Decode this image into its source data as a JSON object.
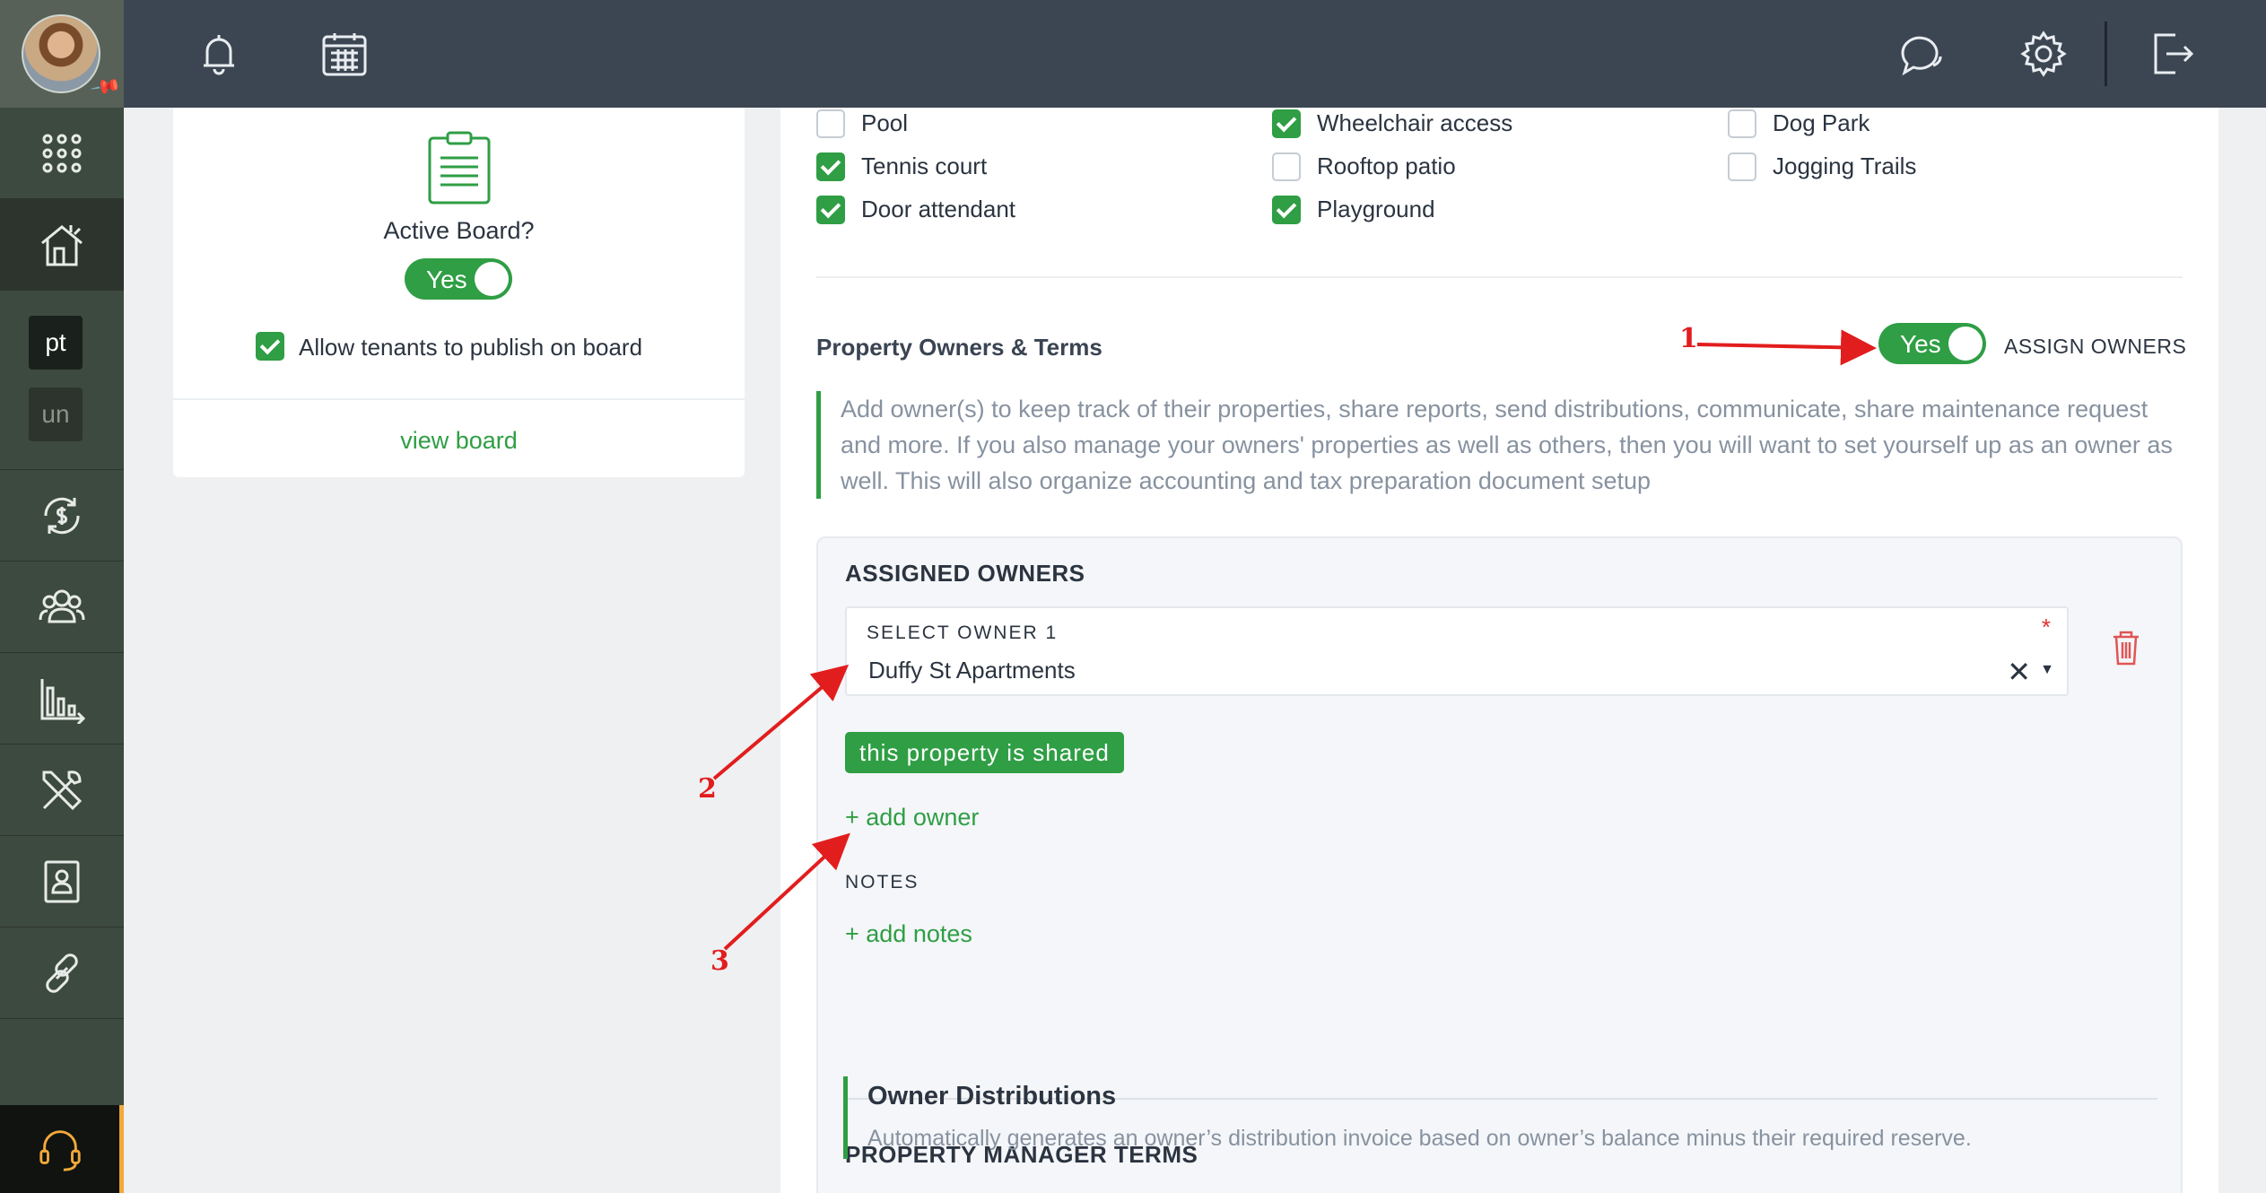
{
  "sidebar": {
    "workspaces": [
      "pt",
      "un"
    ]
  },
  "board": {
    "active_label": "Active Board?",
    "toggle_label": "Yes",
    "allow_label": "Allow tenants to publish on board",
    "view_link": "view board"
  },
  "amenities": [
    {
      "label": "Pool",
      "checked": false
    },
    {
      "label": "Wheelchair access",
      "checked": true
    },
    {
      "label": "Dog Park",
      "checked": false
    },
    {
      "label": "Tennis court",
      "checked": true
    },
    {
      "label": "Rooftop patio",
      "checked": false
    },
    {
      "label": "Jogging Trails",
      "checked": false
    },
    {
      "label": "Door attendant",
      "checked": true
    },
    {
      "label": "Playground",
      "checked": true
    }
  ],
  "owners": {
    "section_title": "Property Owners & Terms",
    "toggle_label": "Yes",
    "assign_label": "ASSIGN OWNERS",
    "info": "Add owner(s) to keep track of their properties, share reports, send distributions, communicate, share maintenance request and more. If you also manage your owners' properties as well as others, then you will want to set yourself up as an owner as well. This will also organize accounting and tax preparation document setup",
    "assigned_heading": "ASSIGNED OWNERS",
    "select_label": "SELECT OWNER 1",
    "required_mark": "*",
    "select_value": "Duffy St Apartments",
    "shared_badge": "this property is shared",
    "add_owner": "+ add owner",
    "notes_label": "NOTES",
    "add_notes": "+ add notes",
    "pm_terms_heading": "PROPERTY MANAGER TERMS",
    "dist_title": "Owner Distributions",
    "dist_desc": "Automatically generates an owner’s distribution invoice based on owner’s balance minus their required reserve."
  },
  "annotations": [
    "1",
    "2",
    "3"
  ],
  "colors": {
    "accent_green": "#2f9e44",
    "topbar": "#3c4652",
    "sidebar": "#3d4a3f",
    "annotation_red": "#e21d1d",
    "support_orange": "#f2a93b"
  },
  "icons": [
    "bell-icon",
    "calendar-icon",
    "chat-icon",
    "gear-icon",
    "logout-icon",
    "apps-grid-icon",
    "property-house-icon",
    "dollar-cycle-icon",
    "people-icon",
    "bar-chart-icon",
    "tools-icon",
    "contact-card-icon",
    "link-icon",
    "headset-icon",
    "clipboard-icon",
    "trash-icon",
    "pin-icon"
  ]
}
